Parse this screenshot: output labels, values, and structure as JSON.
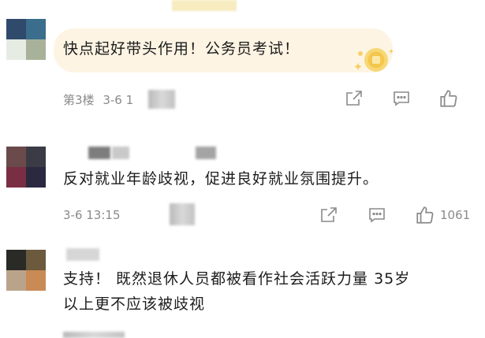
{
  "comments": [
    {
      "text_lines": [
        "快点起好带头作用！公务员考试！"
      ],
      "floor": "第3楼",
      "date": "3-6 1",
      "like_count": ""
    },
    {
      "text_lines": [
        "反对就业年龄歧视，促进良好就业氛围提升。"
      ],
      "floor": "",
      "date": "3-6 13:15",
      "like_count": "1061"
    },
    {
      "text_lines": [
        "支持！ 既然退休人员都被看作社会活跃力量 35岁",
        "以上更不应该被歧视"
      ],
      "floor": "",
      "date": "",
      "like_count": ""
    }
  ],
  "icons": {
    "share": "share-icon",
    "reply": "comment-icon",
    "like": "thumbs-up-icon",
    "sticker": "gold-coin-sticker"
  },
  "colors": {
    "bubble": "#fdf4e3",
    "meta_text": "#8a8a8a"
  }
}
